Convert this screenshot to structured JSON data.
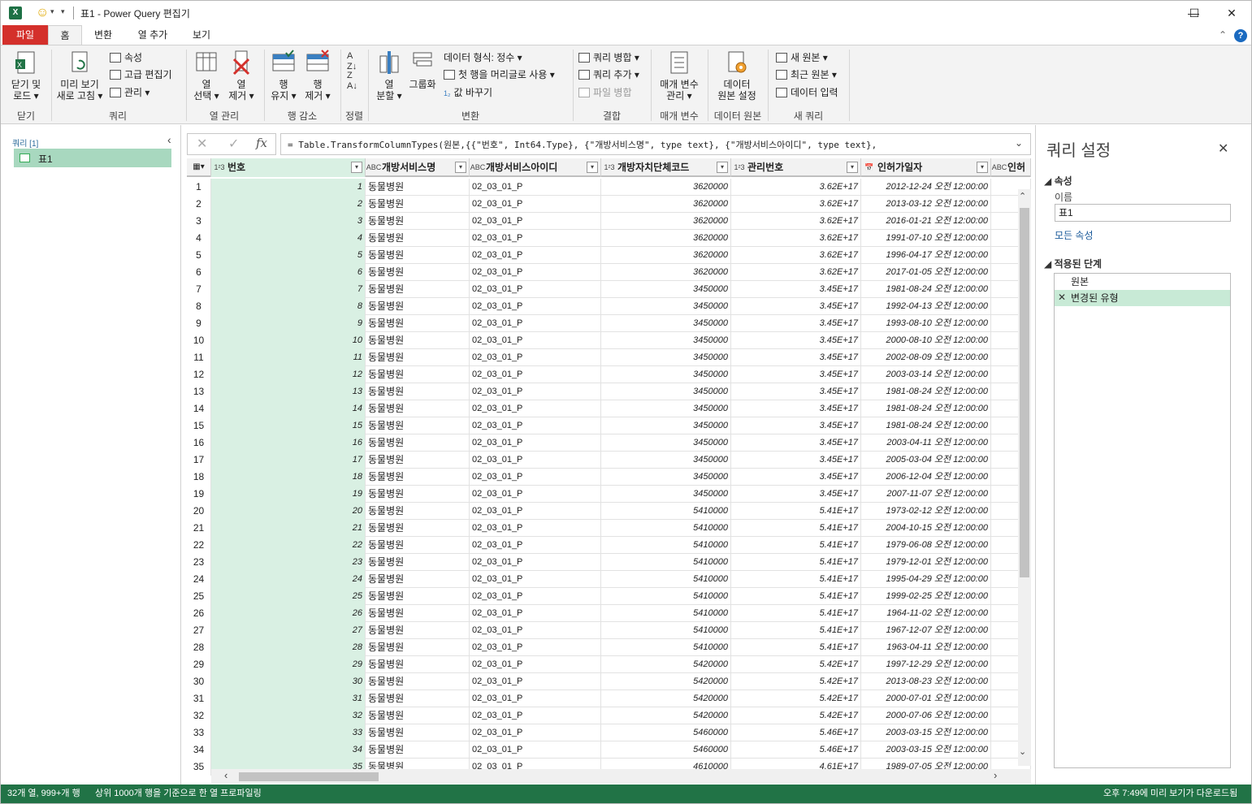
{
  "window": {
    "title": "표1 - Power Query 편집기",
    "minimize": "—",
    "maximize": "☐",
    "close": "✕"
  },
  "tabs": [
    "파일",
    "홈",
    "변환",
    "열 추가",
    "보기"
  ],
  "ribbon": {
    "close_load": "닫기 및\n로드",
    "close_load_l1": "닫기 및",
    "close_load_l2": "로드 ▾",
    "group_close": "닫기",
    "refresh_l1": "미리 보기",
    "refresh_l2": "새로 고침 ▾",
    "properties": "속성",
    "advanced_editor": "고급 편집기",
    "manage": "관리 ▾",
    "group_query": "쿼리",
    "choose_cols_l1": "열",
    "choose_cols_l2": "선택 ▾",
    "remove_cols_l1": "열",
    "remove_cols_l2": "제거 ▾",
    "group_manage_cols": "열 관리",
    "keep_rows_l1": "행",
    "keep_rows_l2": "유지 ▾",
    "remove_rows_l1": "행",
    "remove_rows_l2": "제거 ▾",
    "group_reduce_rows": "행 감소",
    "sort_asc": "↓A Z",
    "group_sort": "정렬",
    "split_l1": "열",
    "split_l2": "분할 ▾",
    "group_by": "그룹화",
    "data_type": "데이터 형식: 정수 ▾",
    "first_row_header": "첫 행을 머리글로 사용 ▾",
    "replace_values": "값 바꾸기",
    "group_transform": "변환",
    "merge_queries": "쿼리 병합 ▾",
    "append_queries": "쿼리 추가 ▾",
    "combine_files": "파일 병합",
    "group_combine": "결합",
    "manage_params_l1": "매개 변수",
    "manage_params_l2": "관리 ▾",
    "group_params": "매개 변수",
    "data_source_l1": "데이터",
    "data_source_l2": "원본 설정",
    "group_data_source": "데이터 원본",
    "new_source": "새 원본 ▾",
    "recent_sources": "최근 원본 ▾",
    "enter_data": "데이터 입력",
    "group_new_query": "새 쿼리"
  },
  "query_pane": {
    "header": "쿼리 [1]",
    "items": [
      "표1"
    ]
  },
  "formula_bar": {
    "cancel": "✕",
    "confirm": "✓",
    "fx": "fx",
    "formula": "= Table.TransformColumnTypes(원본,{{\"번호\", Int64.Type}, {\"개방서비스명\", type text}, {\"개방서비스아이디\", type text},"
  },
  "columns": [
    {
      "type": "1²3",
      "name": "번호"
    },
    {
      "type": "ABC",
      "name": "개방서비스명"
    },
    {
      "type": "ABC",
      "name": "개방서비스아이디"
    },
    {
      "type": "1²3",
      "name": "개방자치단체코드"
    },
    {
      "type": "1²3",
      "name": "관리번호"
    },
    {
      "type": "📅",
      "name": "인허가일자"
    },
    {
      "type": "ABC",
      "name": "인허"
    }
  ],
  "rows": [
    [
      "1",
      "1",
      "동물병원",
      "02_03_01_P",
      "3620000",
      "3.62E+17",
      "2012-12-24 오전 12:00:00"
    ],
    [
      "2",
      "2",
      "동물병원",
      "02_03_01_P",
      "3620000",
      "3.62E+17",
      "2013-03-12 오전 12:00:00"
    ],
    [
      "3",
      "3",
      "동물병원",
      "02_03_01_P",
      "3620000",
      "3.62E+17",
      "2016-01-21 오전 12:00:00"
    ],
    [
      "4",
      "4",
      "동물병원",
      "02_03_01_P",
      "3620000",
      "3.62E+17",
      "1991-07-10 오전 12:00:00"
    ],
    [
      "5",
      "5",
      "동물병원",
      "02_03_01_P",
      "3620000",
      "3.62E+17",
      "1996-04-17 오전 12:00:00"
    ],
    [
      "6",
      "6",
      "동물병원",
      "02_03_01_P",
      "3620000",
      "3.62E+17",
      "2017-01-05 오전 12:00:00"
    ],
    [
      "7",
      "7",
      "동물병원",
      "02_03_01_P",
      "3450000",
      "3.45E+17",
      "1981-08-24 오전 12:00:00"
    ],
    [
      "8",
      "8",
      "동물병원",
      "02_03_01_P",
      "3450000",
      "3.45E+17",
      "1992-04-13 오전 12:00:00"
    ],
    [
      "9",
      "9",
      "동물병원",
      "02_03_01_P",
      "3450000",
      "3.45E+17",
      "1993-08-10 오전 12:00:00"
    ],
    [
      "10",
      "10",
      "동물병원",
      "02_03_01_P",
      "3450000",
      "3.45E+17",
      "2000-08-10 오전 12:00:00"
    ],
    [
      "11",
      "11",
      "동물병원",
      "02_03_01_P",
      "3450000",
      "3.45E+17",
      "2002-08-09 오전 12:00:00"
    ],
    [
      "12",
      "12",
      "동물병원",
      "02_03_01_P",
      "3450000",
      "3.45E+17",
      "2003-03-14 오전 12:00:00"
    ],
    [
      "13",
      "13",
      "동물병원",
      "02_03_01_P",
      "3450000",
      "3.45E+17",
      "1981-08-24 오전 12:00:00"
    ],
    [
      "14",
      "14",
      "동물병원",
      "02_03_01_P",
      "3450000",
      "3.45E+17",
      "1981-08-24 오전 12:00:00"
    ],
    [
      "15",
      "15",
      "동물병원",
      "02_03_01_P",
      "3450000",
      "3.45E+17",
      "1981-08-24 오전 12:00:00"
    ],
    [
      "16",
      "16",
      "동물병원",
      "02_03_01_P",
      "3450000",
      "3.45E+17",
      "2003-04-11 오전 12:00:00"
    ],
    [
      "17",
      "17",
      "동물병원",
      "02_03_01_P",
      "3450000",
      "3.45E+17",
      "2005-03-04 오전 12:00:00"
    ],
    [
      "18",
      "18",
      "동물병원",
      "02_03_01_P",
      "3450000",
      "3.45E+17",
      "2006-12-04 오전 12:00:00"
    ],
    [
      "19",
      "19",
      "동물병원",
      "02_03_01_P",
      "3450000",
      "3.45E+17",
      "2007-11-07 오전 12:00:00"
    ],
    [
      "20",
      "20",
      "동물병원",
      "02_03_01_P",
      "5410000",
      "5.41E+17",
      "1973-02-12 오전 12:00:00"
    ],
    [
      "21",
      "21",
      "동물병원",
      "02_03_01_P",
      "5410000",
      "5.41E+17",
      "2004-10-15 오전 12:00:00"
    ],
    [
      "22",
      "22",
      "동물병원",
      "02_03_01_P",
      "5410000",
      "5.41E+17",
      "1979-06-08 오전 12:00:00"
    ],
    [
      "23",
      "23",
      "동물병원",
      "02_03_01_P",
      "5410000",
      "5.41E+17",
      "1979-12-01 오전 12:00:00"
    ],
    [
      "24",
      "24",
      "동물병원",
      "02_03_01_P",
      "5410000",
      "5.41E+17",
      "1995-04-29 오전 12:00:00"
    ],
    [
      "25",
      "25",
      "동물병원",
      "02_03_01_P",
      "5410000",
      "5.41E+17",
      "1999-02-25 오전 12:00:00"
    ],
    [
      "26",
      "26",
      "동물병원",
      "02_03_01_P",
      "5410000",
      "5.41E+17",
      "1964-11-02 오전 12:00:00"
    ],
    [
      "27",
      "27",
      "동물병원",
      "02_03_01_P",
      "5410000",
      "5.41E+17",
      "1967-12-07 오전 12:00:00"
    ],
    [
      "28",
      "28",
      "동물병원",
      "02_03_01_P",
      "5410000",
      "5.41E+17",
      "1963-04-11 오전 12:00:00"
    ],
    [
      "29",
      "29",
      "동물병원",
      "02_03_01_P",
      "5420000",
      "5.42E+17",
      "1997-12-29 오전 12:00:00"
    ],
    [
      "30",
      "30",
      "동물병원",
      "02_03_01_P",
      "5420000",
      "5.42E+17",
      "2013-08-23 오전 12:00:00"
    ],
    [
      "31",
      "31",
      "동물병원",
      "02_03_01_P",
      "5420000",
      "5.42E+17",
      "2000-07-01 오전 12:00:00"
    ],
    [
      "32",
      "32",
      "동물병원",
      "02_03_01_P",
      "5420000",
      "5.42E+17",
      "2000-07-06 오전 12:00:00"
    ],
    [
      "33",
      "33",
      "동물병원",
      "02_03_01_P",
      "5460000",
      "5.46E+17",
      "2003-03-15 오전 12:00:00"
    ],
    [
      "34",
      "34",
      "동물병원",
      "02_03_01_P",
      "5460000",
      "5.46E+17",
      "2003-03-15 오전 12:00:00"
    ],
    [
      "35",
      "35",
      "동물병원",
      "02_03_01_P",
      "4610000",
      "4.61E+17",
      "1989-07-05 오전 12:00:00"
    ]
  ],
  "settings": {
    "title": "쿼리 설정",
    "properties_header": "◢ 속성",
    "name_label": "이름",
    "name_value": "표1",
    "all_properties": "모든 속성",
    "steps_header": "◢ 적용된 단계",
    "steps": [
      "원본",
      "변경된 유형"
    ]
  },
  "status": {
    "left": "32개 열, 999+개 행",
    "profiling": "상위 1000개 행을 기준으로 한 열 프로파일링",
    "right": "오후 7:49에 미리 보기가 다운로드됨"
  },
  "colors": {
    "excel_green": "#217346",
    "file_tab_red": "#d4302b",
    "selected_col": "#d9f0e3"
  }
}
